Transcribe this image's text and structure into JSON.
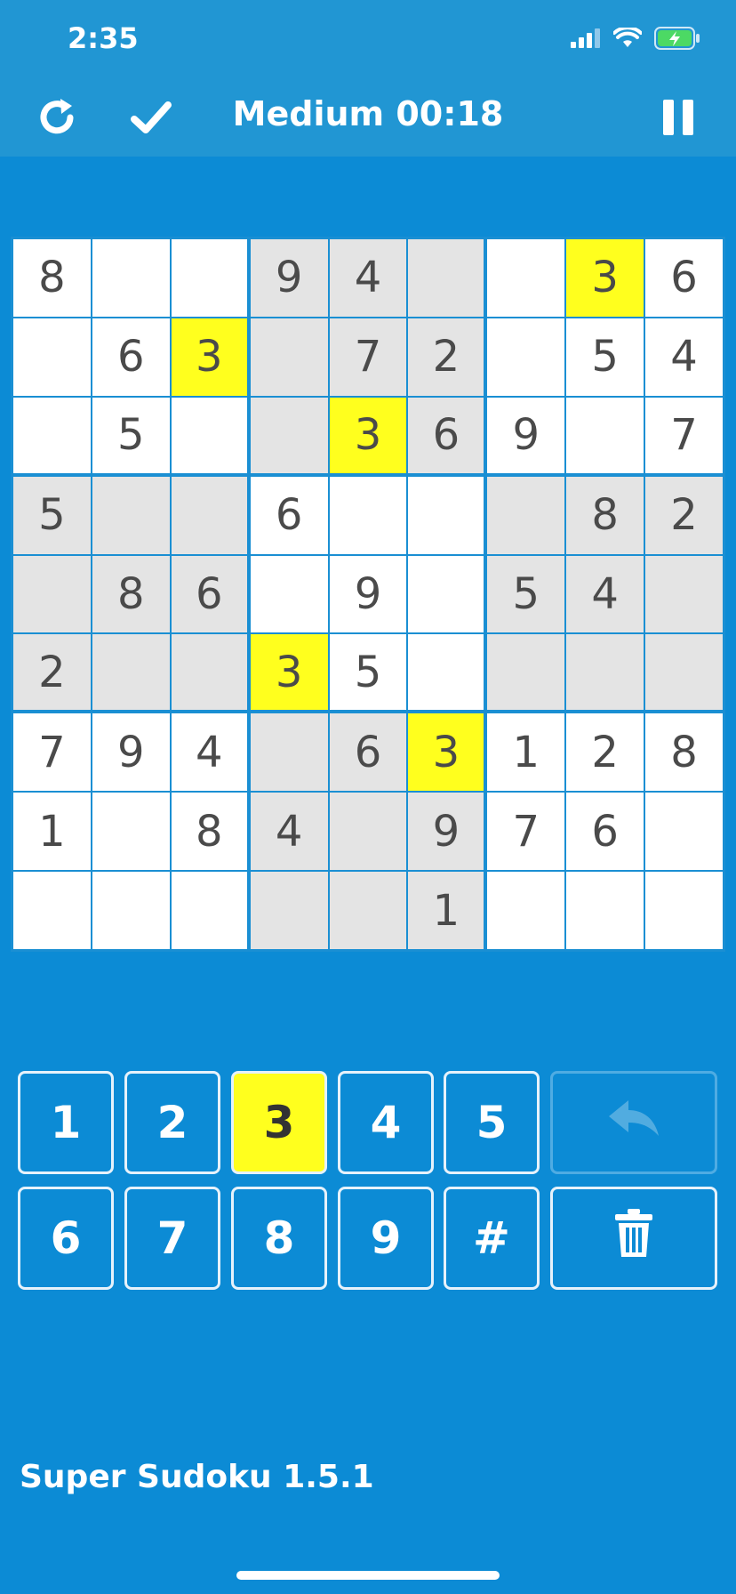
{
  "status": {
    "time": "2:35",
    "icons": [
      "cellular-signal-icon",
      "wifi-icon",
      "battery-charging-icon"
    ]
  },
  "header": {
    "title": "Medium 00:18",
    "restart_icon": "restart-icon",
    "check_icon": "check-icon",
    "pause_icon": "pause-icon"
  },
  "board": {
    "highlight_digit": "3",
    "rows": [
      [
        "8",
        "",
        "",
        "9",
        "4",
        "",
        "",
        "3",
        "6"
      ],
      [
        "",
        "6",
        "3",
        "",
        "7",
        "2",
        "",
        "5",
        "4"
      ],
      [
        "",
        "5",
        "",
        "",
        "3",
        "6",
        "9",
        "",
        "7"
      ],
      [
        "5",
        "",
        "",
        "6",
        "",
        "",
        "",
        "8",
        "2"
      ],
      [
        "",
        "8",
        "6",
        "",
        "9",
        "",
        "5",
        "4",
        ""
      ],
      [
        "2",
        "",
        "",
        "3",
        "5",
        "",
        "",
        "",
        ""
      ],
      [
        "7",
        "9",
        "4",
        "",
        "6",
        "3",
        "1",
        "2",
        "8"
      ],
      [
        "1",
        "",
        "8",
        "4",
        "",
        "9",
        "7",
        "6",
        ""
      ],
      [
        "",
        "",
        "",
        "",
        "",
        "1",
        "",
        "",
        ""
      ]
    ]
  },
  "keypad": {
    "row1": [
      "1",
      "2",
      "3",
      "4",
      "5"
    ],
    "row2": [
      "6",
      "7",
      "8",
      "9",
      "#"
    ],
    "selected": "3",
    "undo_icon": "undo-icon",
    "delete_icon": "trash-icon"
  },
  "footer": {
    "version_text": "Super Sudoku 1.5.1"
  },
  "colors": {
    "background": "#0c8bd5",
    "header": "#2196d3",
    "highlight": "#ffff1e",
    "shaded_cell": "#e4e4e4",
    "digit": "#4a4a4a"
  }
}
